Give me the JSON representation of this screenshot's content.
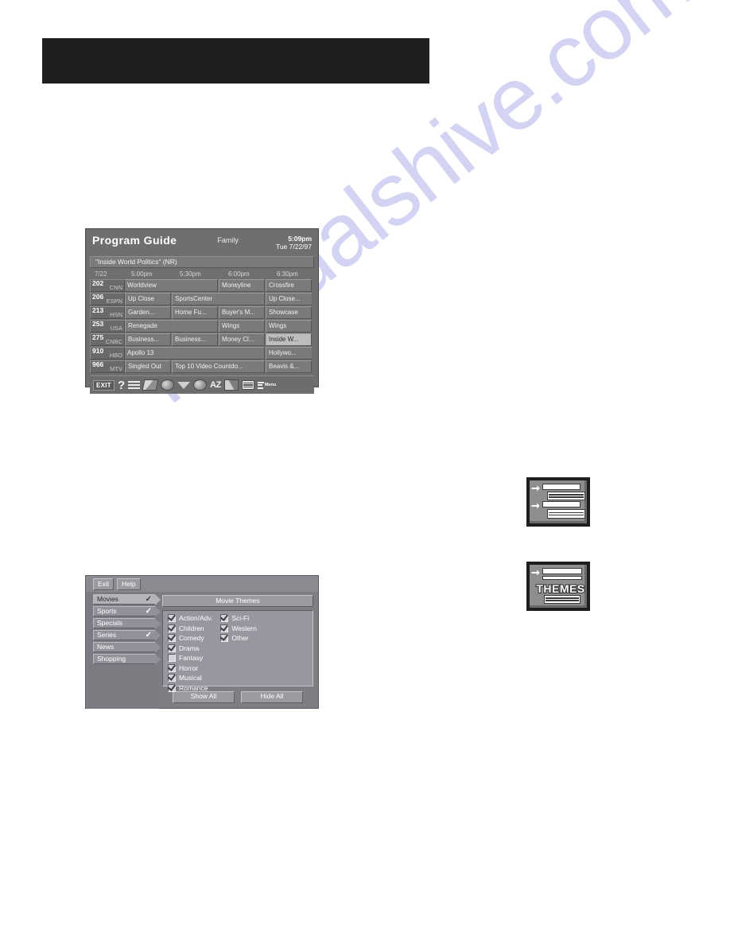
{
  "watermark": {
    "text": "manualshive.com"
  },
  "program_guide": {
    "title": "Program Guide",
    "category": "Family",
    "time": "5:09pm",
    "date": "Tue 7/22/97",
    "now_showing": "\"Inside World Politics\" (NR)",
    "date_column": "7/22",
    "time_slots": [
      "5:00pm",
      "5:30pm",
      "6:00pm",
      "6:30pm"
    ],
    "rows": [
      {
        "channel": "202",
        "callsign": "CNN",
        "programs": [
          {
            "title": "Worldview",
            "span": 2,
            "selected": false,
            "continues_left": true
          },
          {
            "title": "Moneyline",
            "span": 1,
            "selected": false
          },
          {
            "title": "Crossfire",
            "span": 1,
            "selected": false
          }
        ]
      },
      {
        "channel": "206",
        "callsign": "ESPN",
        "programs": [
          {
            "title": "Up Close",
            "span": 1,
            "selected": false
          },
          {
            "title": "SportsCenter",
            "span": 2,
            "selected": false
          },
          {
            "title": "Up Close...",
            "span": 1,
            "selected": false,
            "continues_right": true
          }
        ]
      },
      {
        "channel": "213",
        "callsign": "HSN",
        "programs": [
          {
            "title": "Garden...",
            "span": 1,
            "selected": false
          },
          {
            "title": "Home Fu...",
            "span": 1,
            "selected": false
          },
          {
            "title": "Buyer's M...",
            "span": 1,
            "selected": false
          },
          {
            "title": "Showcase",
            "span": 1,
            "selected": false
          }
        ]
      },
      {
        "channel": "253",
        "callsign": "USA",
        "programs": [
          {
            "title": "Renegade",
            "span": 2,
            "selected": false
          },
          {
            "title": "Wings",
            "span": 1,
            "selected": false
          },
          {
            "title": "Wings",
            "span": 1,
            "selected": false
          }
        ]
      },
      {
        "channel": "275",
        "callsign": "CNBC",
        "programs": [
          {
            "title": "Business...",
            "span": 1,
            "selected": false
          },
          {
            "title": "Business...",
            "span": 1,
            "selected": false
          },
          {
            "title": "Money Cl...",
            "span": 1,
            "selected": false
          },
          {
            "title": "Inside W...",
            "span": 1,
            "selected": true
          }
        ]
      },
      {
        "channel": "910",
        "callsign": "HBO",
        "programs": [
          {
            "title": "Apollo 13",
            "span": 3,
            "selected": false,
            "continues_left": true
          },
          {
            "title": "Hollywo...",
            "span": 1,
            "selected": false,
            "continues_right": true
          }
        ]
      },
      {
        "channel": "966",
        "callsign": "MTV",
        "programs": [
          {
            "title": "Singled Out",
            "span": 1,
            "selected": false
          },
          {
            "title": "Top 10 Video Countdo...",
            "span": 2,
            "selected": false
          },
          {
            "title": "Beavis &...",
            "span": 1,
            "selected": false
          }
        ]
      }
    ],
    "toolbar": [
      {
        "name": "exit-button",
        "label": "EXIT",
        "kind": "exit"
      },
      {
        "name": "help-icon",
        "label": "?",
        "kind": "question"
      },
      {
        "name": "list-icon",
        "label": "",
        "kind": "lines"
      },
      {
        "name": "edit-pencil-icon",
        "label": "",
        "kind": "pen"
      },
      {
        "name": "globe-icon",
        "label": "",
        "kind": "circle"
      },
      {
        "name": "down-arrow-icon",
        "label": "",
        "kind": "triangle"
      },
      {
        "name": "themes-clock-icon",
        "label": "",
        "kind": "circle"
      },
      {
        "name": "alphabetical-sort-icon",
        "label": "AZ",
        "kind": "az"
      },
      {
        "name": "satellite-icon",
        "label": "",
        "kind": "satellite"
      },
      {
        "name": "grid-icon",
        "label": "",
        "kind": "grid"
      },
      {
        "name": "menu-icon",
        "label": "Menu",
        "kind": "menu"
      }
    ]
  },
  "themes_dialog": {
    "exit_label": "Exit",
    "help_label": "Help",
    "categories": [
      {
        "label": "Movies",
        "checked": true,
        "active": true
      },
      {
        "label": "Sports",
        "checked": true,
        "active": false
      },
      {
        "label": "Specials",
        "checked": false,
        "active": false
      },
      {
        "label": "Series",
        "checked": true,
        "active": false
      },
      {
        "label": "News",
        "checked": false,
        "active": false
      },
      {
        "label": "Shopping",
        "checked": false,
        "active": false
      }
    ],
    "heading": "Movie Themes",
    "options_left": [
      {
        "label": "Action/Adv.",
        "checked": true
      },
      {
        "label": "Children",
        "checked": true
      },
      {
        "label": "Comedy",
        "checked": true
      },
      {
        "label": "Drama",
        "checked": true
      },
      {
        "label": "Fantasy",
        "checked": false
      },
      {
        "label": "Horror",
        "checked": true
      },
      {
        "label": "Musical",
        "checked": true
      },
      {
        "label": "Romance",
        "checked": true
      }
    ],
    "options_right": [
      {
        "label": "Sci-Fi",
        "checked": true
      },
      {
        "label": "Western",
        "checked": true
      },
      {
        "label": "Other",
        "checked": true
      }
    ],
    "show_all_label": "Show All",
    "hide_all_label": "Hide All"
  },
  "key_icons": {
    "list": {
      "name": "guide-list-key-icon"
    },
    "themes": {
      "name": "themes-key-icon",
      "label": "THEMES"
    }
  }
}
